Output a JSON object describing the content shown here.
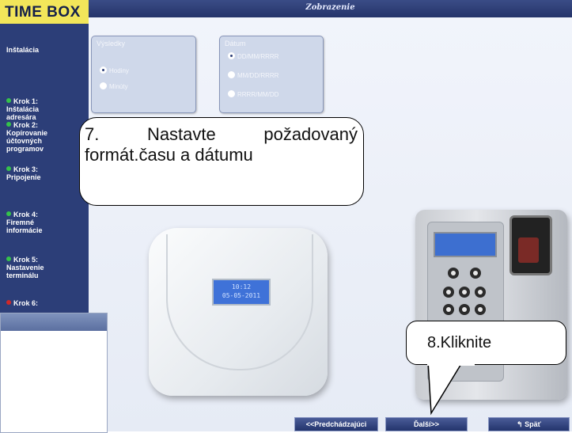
{
  "app": {
    "logo": "TIME BOX",
    "header_title": "Zobrazenie"
  },
  "sidebar": {
    "items": [
      {
        "label": "Inštalácia",
        "bullet": "none"
      },
      {
        "label": "Krok 1:",
        "sub": [
          "Inštalácia",
          "adresára"
        ],
        "bullet": "green"
      },
      {
        "label": "Krok 2:",
        "sub": [
          "Kopírovanie",
          "účtovných",
          "programov"
        ],
        "bullet": "green"
      },
      {
        "label": "Krok 3:",
        "sub": [
          "Pripojenie"
        ],
        "bullet": "green"
      },
      {
        "label": "Krok 4:",
        "sub": [
          "Firemné",
          "informácie"
        ],
        "bullet": "green"
      },
      {
        "label": "Krok 5:",
        "sub": [
          "Nastavenie",
          "terminálu"
        ],
        "bullet": "green"
      },
      {
        "label": "Krok 6:",
        "sub": [],
        "bullet": "red"
      }
    ]
  },
  "groups": {
    "vysledky": {
      "title": "Výsledky",
      "options": [
        {
          "label": "Hodiny",
          "selected": true
        },
        {
          "label": "Minúty",
          "selected": false
        }
      ]
    },
    "datum": {
      "title": "Dátum",
      "options": [
        {
          "label": "DD/MM/RRRR",
          "selected": true
        },
        {
          "label": "MM/DD/RRRR",
          "selected": false
        },
        {
          "label": "RRRR/MM/DD",
          "selected": false
        }
      ]
    }
  },
  "callouts": {
    "step7_line1_words": [
      "7.",
      "Nastavte",
      "požadovaný"
    ],
    "step7_line2": "formát.času a dátumu",
    "step8": "8.Kliknite"
  },
  "devices": {
    "lcd1_line1": "10:12",
    "lcd1_line2": "05-05-2011"
  },
  "buttons": {
    "previous": "<<Predchádzajúci",
    "next": "Ďalší>>",
    "back": "Späť",
    "back_icon": "back-arrow-icon"
  },
  "colors": {
    "sidebar": "#2c3e78",
    "logo_bg": "#f2e65a",
    "step_done": "#35c24a",
    "step_current": "#d02828",
    "lcd": "#3f72d8"
  }
}
